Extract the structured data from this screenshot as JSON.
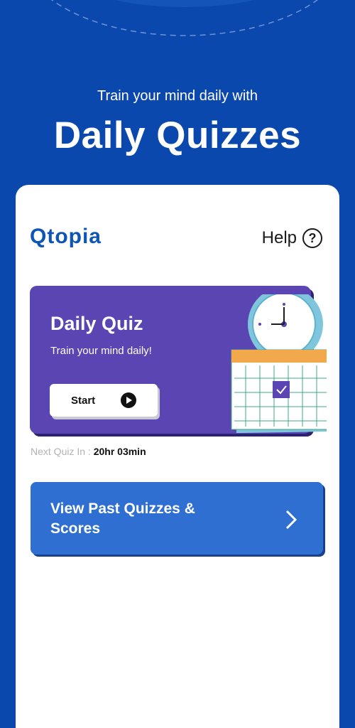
{
  "hero": {
    "subtitle": "Train your mind daily with",
    "title": "Daily Quizzes"
  },
  "header": {
    "logo": "Qtopia",
    "help_label": "Help",
    "help_icon": "?"
  },
  "daily_quiz": {
    "title": "Daily Quiz",
    "subtitle": "Train your mind daily!",
    "start_label": "Start"
  },
  "next_quiz": {
    "label": "Next Quiz In :",
    "value": "20hr 03min"
  },
  "past_quizzes": {
    "label": "View Past Quizzes & Scores"
  },
  "colors": {
    "background": "#0a48ad",
    "card": "#ffffff",
    "quiz_card": "#5b45b2",
    "past_button": "#2f6fd1",
    "logo": "#0e55b4"
  },
  "icons": {
    "help": "question-circle-icon",
    "start": "play-icon",
    "past": "chevron-right-icon",
    "illustration": "clock-calendar-icon"
  }
}
